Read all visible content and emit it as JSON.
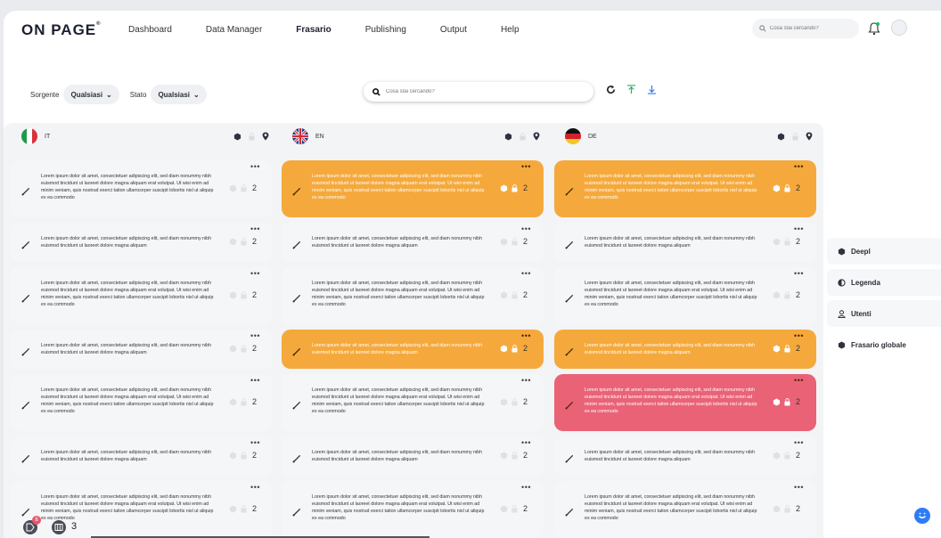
{
  "app": {
    "logo": "ON PAGE",
    "logo_mark": "®"
  },
  "nav": {
    "items": [
      "Dashboard",
      "Data Manager",
      "Frasario",
      "Publishing",
      "Output",
      "Help"
    ],
    "active": "Frasario"
  },
  "top_search": {
    "placeholder": "Cosa stai cercando?"
  },
  "filters": {
    "source_label": "Sorgente",
    "source_value": "Qualsiasi",
    "state_label": "Stato",
    "state_value": "Qualsiasi"
  },
  "main_search": {
    "placeholder": "Cosa stai cercando?"
  },
  "columns": [
    {
      "lang": "IT",
      "flag": "italy"
    },
    {
      "lang": "EN",
      "flag": "uk"
    },
    {
      "lang": "DE",
      "flag": "germany"
    }
  ],
  "texts": {
    "long": "Lorem ipsum dolor sit amet, consectetuer adipiscing elit, sed diam nonummy nibh euismod tincidunt ut laoreet dolore magna aliquam erat volutpat. Ut wisi enim ad minim veniam, quis nostrud exerci tation ullamcorper suscipit lobortis nisl ut aliquip ex ea commodo",
    "short": "Lorem ipsum dolor sit amet, consectetuer adipiscing elit, sed diam nonummy nibh euismod tincidunt ut laoreet dolore magna aliquam"
  },
  "rows": [
    {
      "length": "long",
      "states": [
        "white",
        "orange",
        "orange"
      ],
      "count": "2"
    },
    {
      "length": "short",
      "states": [
        "white",
        "white",
        "white"
      ],
      "count": "2"
    },
    {
      "length": "long",
      "states": [
        "white",
        "white",
        "white"
      ],
      "count": "2"
    },
    {
      "length": "short",
      "states": [
        "white",
        "orange",
        "orange"
      ],
      "count": "2"
    },
    {
      "length": "long",
      "states": [
        "white",
        "white",
        "red"
      ],
      "count": "2"
    },
    {
      "length": "short",
      "states": [
        "white",
        "white",
        "white"
      ],
      "count": "2"
    },
    {
      "length": "long",
      "states": [
        "white",
        "white",
        "white"
      ],
      "count": "2"
    }
  ],
  "card_menu": "•••",
  "side_panel": [
    {
      "label": "Deepl",
      "icon": "deepl-icon"
    },
    {
      "label": "Legenda",
      "icon": "half-circle-icon"
    },
    {
      "label": "Utenti",
      "icon": "user-icon"
    },
    {
      "label": "Frasario globale",
      "icon": "deepl-icon"
    }
  ],
  "footer": {
    "badge_count": "8",
    "columns_count": "3"
  },
  "colors": {
    "orange": "#f5a93c",
    "red": "#ea6276",
    "accent_green": "#1fb36b",
    "accent_blue": "#2e7cf6"
  }
}
